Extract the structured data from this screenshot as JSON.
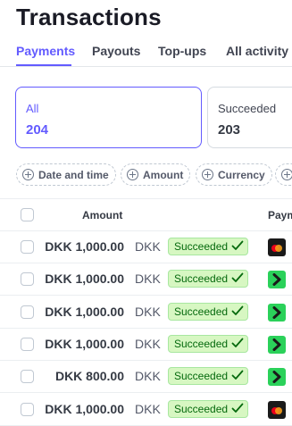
{
  "page_title": "Transactions",
  "tabs": [
    {
      "label": "Payments",
      "active": true
    },
    {
      "label": "Payouts",
      "active": false
    },
    {
      "label": "Top-ups",
      "active": false
    },
    {
      "label": "All activity",
      "active": false
    }
  ],
  "status_cards": [
    {
      "label": "All",
      "count": "204",
      "active": true
    },
    {
      "label": "Succeeded",
      "count": "203",
      "active": false
    }
  ],
  "filters": [
    {
      "label": "Date and time"
    },
    {
      "label": "Amount"
    },
    {
      "label": "Currency"
    },
    {
      "label": ""
    }
  ],
  "table": {
    "headers": {
      "amount": "Amount",
      "payment_method": "Paym"
    },
    "rows": [
      {
        "amount": "DKK 1,000.00",
        "currency": "DKK",
        "status": "Succeeded",
        "payment_method_icon": "mastercard-icon"
      },
      {
        "amount": "DKK 1,000.00",
        "currency": "DKK",
        "status": "Succeeded",
        "payment_method_icon": "mobilepay-icon"
      },
      {
        "amount": "DKK 1,000.00",
        "currency": "DKK",
        "status": "Succeeded",
        "payment_method_icon": "mobilepay-icon"
      },
      {
        "amount": "DKK 1,000.00",
        "currency": "DKK",
        "status": "Succeeded",
        "payment_method_icon": "mobilepay-icon"
      },
      {
        "amount": "DKK 800.00",
        "currency": "DKK",
        "status": "Succeeded",
        "payment_method_icon": "mobilepay-icon"
      },
      {
        "amount": "DKK 1,000.00",
        "currency": "DKK",
        "status": "Succeeded",
        "payment_method_icon": "mastercard-icon"
      }
    ]
  },
  "colors": {
    "accent": "#635bff",
    "success_bg": "#d7f7c2",
    "success_text": "#05690d",
    "success_border": "#a8e7a0"
  }
}
